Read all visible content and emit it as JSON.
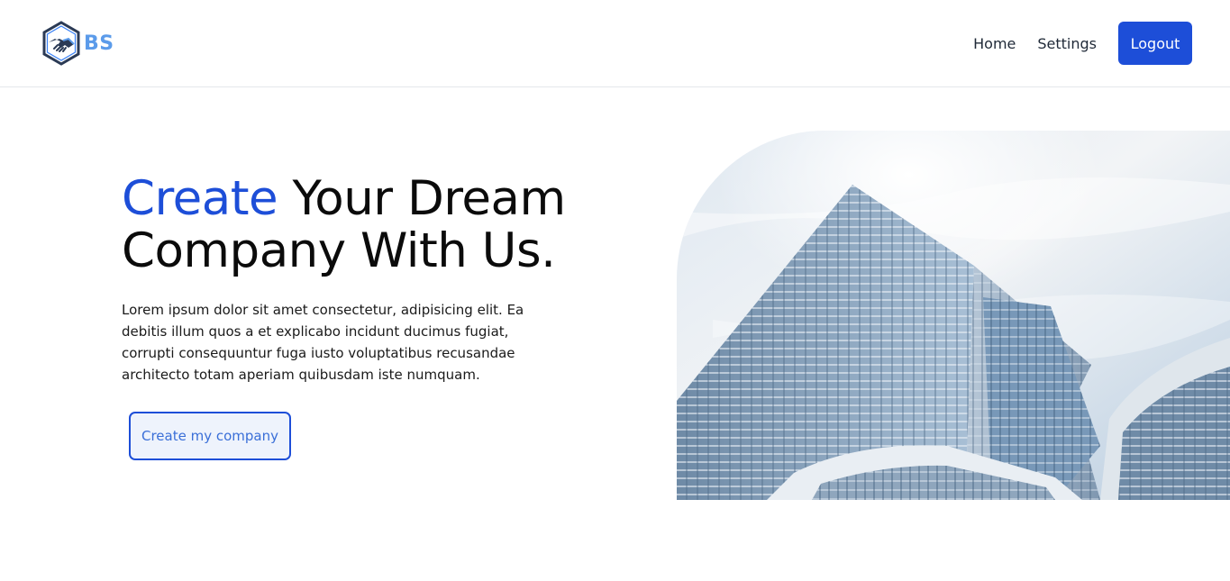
{
  "colors": {
    "accent": "#1d4ed8",
    "brand_light": "#5b9bea",
    "text_dark": "#0b0b0b"
  },
  "header": {
    "logo_text": "BS",
    "logo_icon": "handshake-hexagon-icon",
    "nav": [
      {
        "label": "Home"
      },
      {
        "label": "Settings"
      }
    ],
    "logout_label": "Logout"
  },
  "hero": {
    "title_highlight": "Create",
    "title_line1_rest": " Your Dream",
    "title_line2": "Company With Us.",
    "description": "Lorem ipsum dolor sit amet consectetur, adipisicing elit. Ea debitis illum quos a et explicabo incidunt ducimus fugiat, corrupti consequuntur fuga iusto voluptatibus recusandae architecto totam aperiam quibusdam iste numquam.",
    "cta_label": "Create my company",
    "image": "office-building-photo"
  }
}
